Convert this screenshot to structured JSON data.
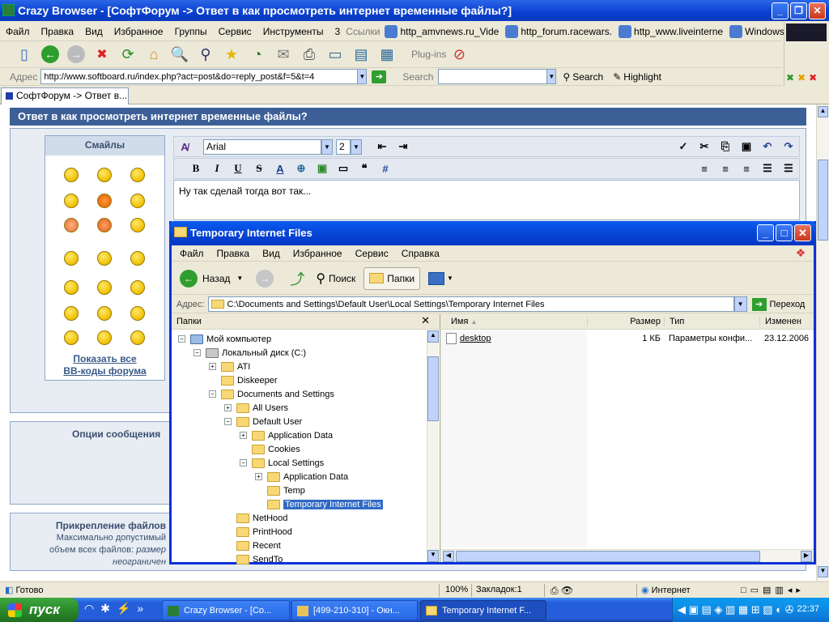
{
  "browser": {
    "title": "Crazy Browser - [СофтФорум -> Ответ в как просмотреть интернет временные файлы?]",
    "menu": [
      "Файл",
      "Правка",
      "Вид",
      "Избранное",
      "Группы",
      "Сервис",
      "Инструменты",
      "3"
    ],
    "links_label": "Ссылки",
    "links": [
      "http_amvnews.ru_Vide",
      "http_forum.racewars.",
      "http_www.liveinterne",
      "Windows"
    ],
    "address_label": "Адрес",
    "address": "http://www.softboard.ru/index.php?act=post&do=reply_post&f=5&t=4",
    "search_label": "Search",
    "search_btn": "Search",
    "highlight_btn": "Highlight",
    "plugins_label": "Plug-ins",
    "tab": "СофтФорум -> Ответ в..."
  },
  "page": {
    "heading": "Ответ в как просмотреть интернет временные файлы?",
    "smilies_title": "Смайлы",
    "show_all_1": "Показать все",
    "show_all_2": "ВВ-коды форума",
    "font_name": "Arial",
    "font_size": "2",
    "editor_text": "Ну так сделай тогда вот так...",
    "options_label": "Опции сообщения",
    "attach_title": "Прикрепление файлов",
    "attach_line1": "Максимально допустимый",
    "attach_line2": "объем всех файлов:",
    "attach_line2b": "размер",
    "attach_line3": "неограничен"
  },
  "explorer": {
    "title": "Temporary Internet Files",
    "menu": [
      "Файл",
      "Правка",
      "Вид",
      "Избранное",
      "Сервис",
      "Справка"
    ],
    "back": "Назад",
    "search": "Поиск",
    "folders": "Папки",
    "address_label": "Адрес:",
    "address": "C:\\Documents and Settings\\Default User\\Local Settings\\Temporary Internet Files",
    "go": "Переход",
    "tree_title": "Папки",
    "tree": [
      {
        "label": "Мой компьютер",
        "box": "−"
      },
      {
        "label": "Локальный диск (C:)",
        "box": "−"
      },
      {
        "label": "ATI",
        "box": "+"
      },
      {
        "label": "Diskeeper",
        "box": ""
      },
      {
        "label": "Documents and Settings",
        "box": "−"
      },
      {
        "label": "All Users",
        "box": "+"
      },
      {
        "label": "Default User",
        "box": "−"
      },
      {
        "label": "Application Data",
        "box": "+"
      },
      {
        "label": "Cookies",
        "box": ""
      },
      {
        "label": "Local Settings",
        "box": "−"
      },
      {
        "label": "Application Data",
        "box": "+"
      },
      {
        "label": "Temp",
        "box": ""
      },
      {
        "label": "Temporary Internet Files",
        "box": ""
      },
      {
        "label": "NetHood",
        "box": ""
      },
      {
        "label": "PrintHood",
        "box": ""
      },
      {
        "label": "Recent",
        "box": ""
      },
      {
        "label": "SendTo",
        "box": ""
      }
    ],
    "columns": [
      "Имя",
      "Размер",
      "Тип",
      "Изменен"
    ],
    "files": [
      {
        "name": "desktop",
        "size": "1 КБ",
        "type": "Параметры конфи...",
        "modified": "23.12.2006"
      }
    ]
  },
  "status": {
    "ready": "Готово",
    "zoom": "100%",
    "bookmarks": "Закладок:1",
    "zone": "Интернет"
  },
  "taskbar": {
    "start": "пуск",
    "tasks": [
      "Crazy Browser - [Co...",
      "[499-210-310] - Окн...",
      "Temporary Internet F..."
    ],
    "clock": "22:37"
  }
}
